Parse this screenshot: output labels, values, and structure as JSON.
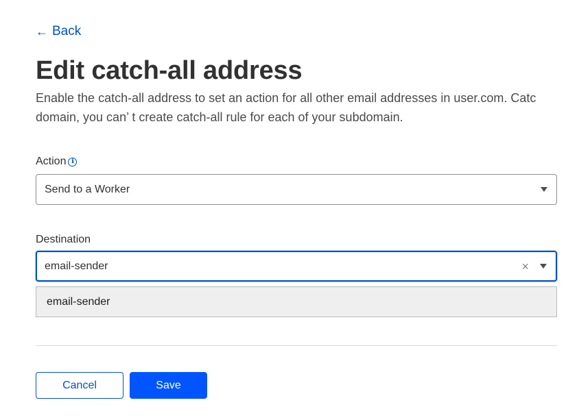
{
  "nav": {
    "back_label": "Back"
  },
  "page": {
    "title": "Edit catch-all address",
    "description_line1": "Enable the catch-all address to set an action for all other email addresses in user.com. Catc",
    "description_line2": "domain, you can’ t create catch-all rule for each of your subdomain."
  },
  "form": {
    "action": {
      "label": "Action",
      "value": "Send to a Worker"
    },
    "destination": {
      "label": "Destination",
      "value": "email-sender",
      "options": [
        "email-sender"
      ]
    }
  },
  "buttons": {
    "cancel_label": "Cancel",
    "save_label": "Save"
  },
  "colors": {
    "link": "#0051c3",
    "primary_button": "#0055ff",
    "focus_border": "#0051c3"
  }
}
